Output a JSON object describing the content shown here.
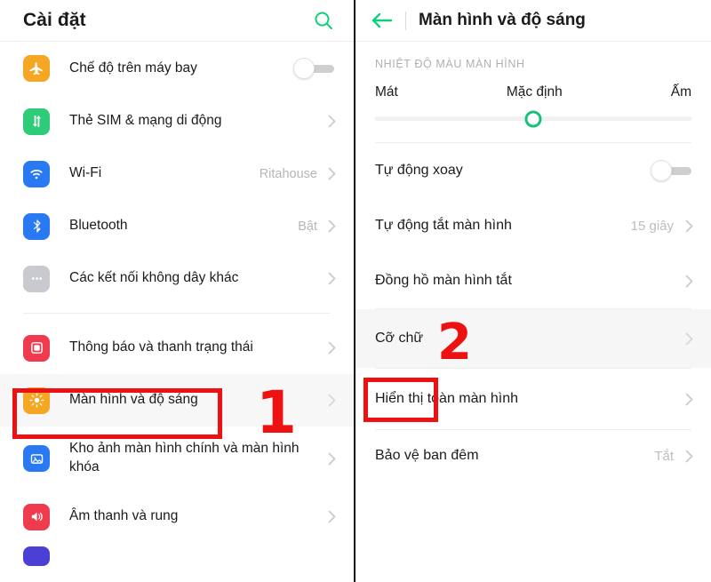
{
  "left_panel": {
    "header": {
      "title": "Cài đặt",
      "search_icon": "search-icon"
    },
    "groups": [
      {
        "items": [
          {
            "label": "Chế độ trên máy bay",
            "icon": "airplane-icon",
            "icon_color": "#f5a623",
            "control": "toggle",
            "toggle_state": "off",
            "value": ""
          },
          {
            "label": "Thẻ SIM & mạng di động",
            "icon": "sim-network-icon",
            "icon_color": "#2ecc78",
            "control": "chevron",
            "value": ""
          },
          {
            "label": "Wi-Fi",
            "icon": "wifi-icon",
            "icon_color": "#2979f2",
            "control": "chevron",
            "value": "Ritahouse"
          },
          {
            "label": "Bluetooth",
            "icon": "bluetooth-icon",
            "icon_color": "#2979f2",
            "control": "chevron",
            "value": "Bật"
          },
          {
            "label": "Các kết nối không dây khác",
            "icon": "more-dots-icon",
            "icon_color": "#c8cad0",
            "control": "chevron",
            "value": ""
          }
        ]
      },
      {
        "items": [
          {
            "label": "Thông báo và thanh trạng thái",
            "icon": "notification-icon",
            "icon_color": "#ef3b4e",
            "control": "chevron",
            "value": ""
          },
          {
            "label": "Màn hình và độ sáng",
            "icon": "brightness-icon",
            "icon_color": "#f5a623",
            "control": "chevron",
            "value": "",
            "highlighted": true
          },
          {
            "label": "Kho ảnh màn hình chính và màn hình khóa",
            "icon": "wallpaper-icon",
            "icon_color": "#2979f2",
            "control": "chevron",
            "value": ""
          },
          {
            "label": "Âm thanh và rung",
            "icon": "sound-icon",
            "icon_color": "#ef3b4e",
            "control": "chevron",
            "value": ""
          },
          {
            "label": "",
            "icon": "partial-icon",
            "icon_color": "#4b3fd6",
            "control": "none",
            "value": ""
          }
        ]
      }
    ]
  },
  "right_panel": {
    "header": {
      "back_icon": "back-arrow-icon",
      "title": "Màn hình và độ sáng"
    },
    "color_temperature": {
      "section_title": "NHIỆT ĐỘ MÀU MÀN HÌNH",
      "label_cool": "Mát",
      "label_default": "Mặc định",
      "label_warm": "Ấm",
      "slider_percent": 50
    },
    "rows": [
      {
        "label": "Tự động xoay",
        "control": "toggle",
        "toggle_state": "off",
        "value": ""
      },
      {
        "label": "Tự động tắt màn hình",
        "control": "chevron",
        "value": "15 giây"
      },
      {
        "label": "Đồng hồ màn hình tắt",
        "control": "chevron",
        "value": ""
      },
      {
        "label": "Cỡ chữ",
        "control": "chevron",
        "value": "",
        "highlighted": true
      },
      {
        "label": "Hiển thị toàn màn hình",
        "control": "chevron",
        "value": ""
      },
      {
        "label": "Bảo vệ ban đêm",
        "control": "chevron",
        "value": "Tắt"
      }
    ]
  },
  "annotations": {
    "step_1": "1",
    "step_2": "2",
    "color": "#ee1111"
  }
}
